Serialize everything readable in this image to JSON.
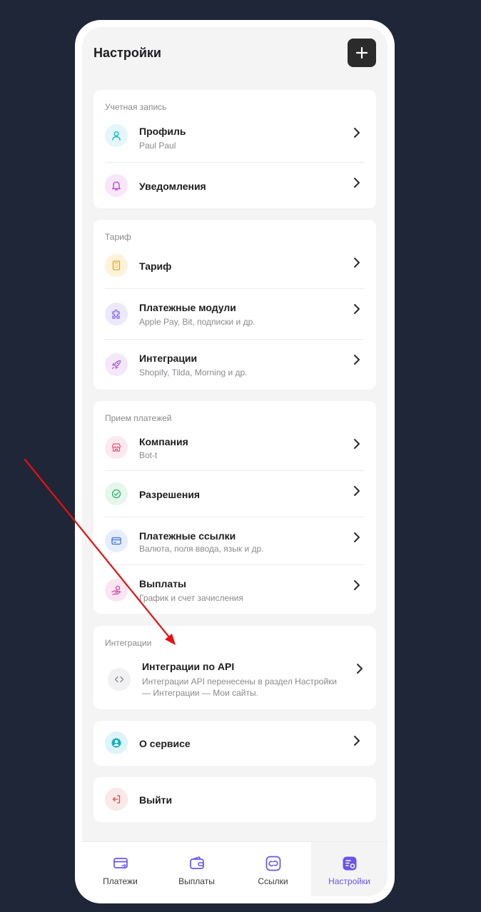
{
  "header": {
    "title": "Настройки",
    "add_label": "+"
  },
  "sections": {
    "account": {
      "label": "Учетная запись",
      "items": [
        {
          "title": "Профиль",
          "subtitle": "Paul Paul",
          "icon": "user-icon"
        },
        {
          "title": "Уведомления",
          "icon": "bell-icon"
        }
      ]
    },
    "tariff": {
      "label": "Тариф",
      "items": [
        {
          "title": "Тариф",
          "icon": "calculator-icon"
        },
        {
          "title": "Платежные модули",
          "subtitle": "Apple Pay, Bit, подписки и др.",
          "icon": "puzzle-icon"
        },
        {
          "title": "Интеграции",
          "subtitle": "Shopify, Tilda, Morning и др.",
          "icon": "rocket-icon"
        }
      ]
    },
    "payments": {
      "label": "Прием платежей",
      "items": [
        {
          "title": "Компания",
          "subtitle": "Bot-t",
          "icon": "store-icon"
        },
        {
          "title": "Разрешения",
          "icon": "check-circle-icon"
        },
        {
          "title": "Платежные ссылки",
          "subtitle": "Валюта, поля ввода, язык и др.",
          "icon": "card-icon"
        },
        {
          "title": "Выплаты",
          "subtitle": "График и счет зачисления",
          "icon": "hand-coin-icon"
        }
      ]
    },
    "integrations": {
      "label": "Интеграции",
      "items": [
        {
          "title": "Интеграции по API",
          "subtitle_line1": "Интеграции API перенесены в раздел Настройки",
          "subtitle_line2": "— Интеграции — Мои сайты.",
          "icon": "code-icon"
        }
      ]
    },
    "about": {
      "title": "О сервисе",
      "icon": "user-circle-icon"
    },
    "logout": {
      "title": "Выйти",
      "icon": "logout-icon"
    }
  },
  "tabbar": [
    {
      "label": "Платежи",
      "icon": "payments-icon"
    },
    {
      "label": "Выплаты",
      "icon": "wallet-icon"
    },
    {
      "label": "Ссылки",
      "icon": "link-icon"
    },
    {
      "label": "Настройки",
      "icon": "settings-icon",
      "active": true
    }
  ],
  "colors": {
    "background": "#1e2638",
    "accent": "#6b55e8",
    "annotation_arrow": "#e81010"
  }
}
